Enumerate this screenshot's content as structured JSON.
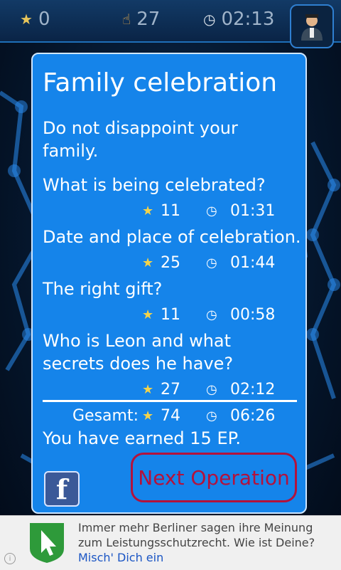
{
  "topbar": {
    "stars": "0",
    "points": "27",
    "time": "02:13",
    "icons": [
      "star-icon",
      "hand-icon",
      "clock-icon",
      "agent-avatar-icon"
    ]
  },
  "dialog": {
    "title": "Family celebration",
    "subtitle": "Do not disappoint your family.",
    "questions": [
      {
        "text": "What is being celebrated?",
        "stars": "11",
        "time": "01:31"
      },
      {
        "text": "Date and place of celebration.",
        "stars": "25",
        "time": "01:44"
      },
      {
        "text": "The right gift?",
        "stars": "11",
        "time": "00:58"
      },
      {
        "text": "Who is Leon and what secrets does he have?",
        "stars": "27",
        "time": "02:12"
      }
    ],
    "total_label": "Gesamt:",
    "total_stars": "74",
    "total_time": "06:26",
    "earned": "You have earned 15 EP.",
    "next_button": "Next Operation",
    "facebook_label": "f"
  },
  "ad": {
    "text": "Immer mehr Berliner sagen ihre Meinung zum Leistungsschutzrecht. Wie ist Deine?",
    "link": "Misch' Dich ein",
    "info": "i"
  },
  "colors": {
    "dialog_bg": "#1584ea",
    "button_accent": "#b3123c",
    "star": "#f4d34a",
    "facebook": "#3b5998"
  }
}
